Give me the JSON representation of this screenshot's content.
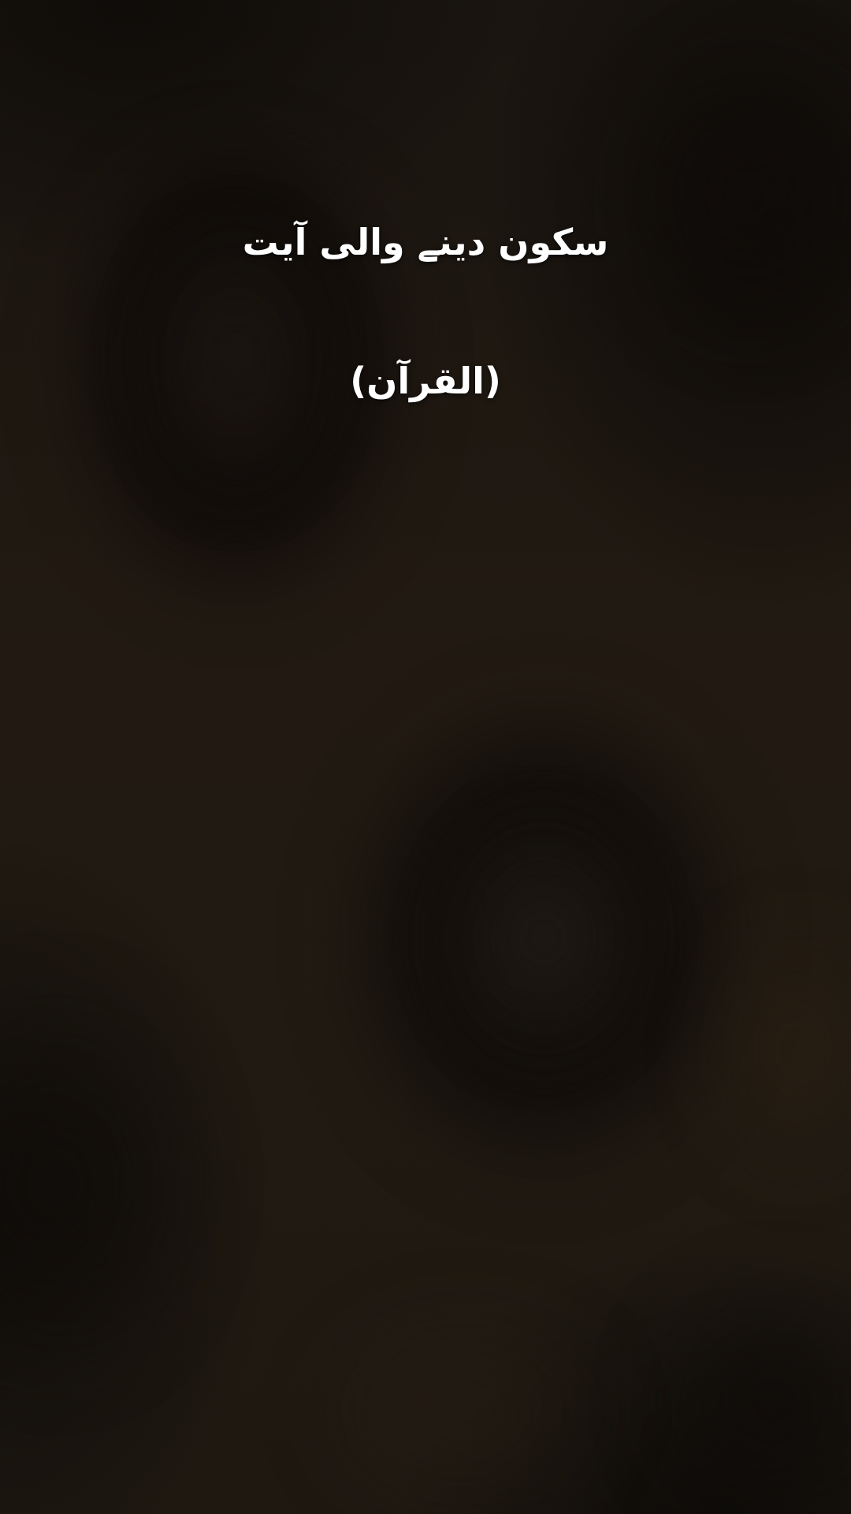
{
  "background": {
    "description_colors": [
      "#1c1610",
      "#110d0a",
      "#221a12"
    ]
  },
  "caption": {
    "title": "سکون دینے والی آیت",
    "source": "(القرآن)"
  },
  "colors": {
    "text": "#ffffff"
  }
}
